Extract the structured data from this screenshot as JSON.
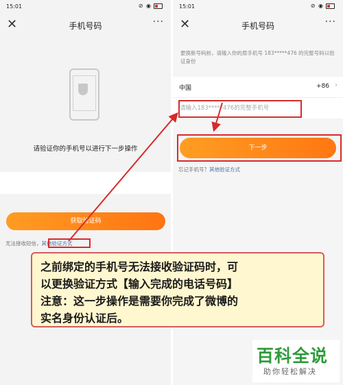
{
  "left_screen": {
    "status": {
      "time": "15:01",
      "signal": "ᴴᴰ",
      "right_icons": "⊘ ◉"
    },
    "nav": {
      "close_glyph": "✕",
      "title": "手机号码",
      "more_glyph": "···"
    },
    "message": "请验证你的手机号以进行下一步操作",
    "get_code_button": "获取验证码",
    "help_text": "无法接收短信，",
    "other_method_link": "其他验证方式"
  },
  "right_screen": {
    "status": {
      "time": "15:01",
      "signal": "ᴴᴰ",
      "right_icons": "⊘ ◉"
    },
    "nav": {
      "close_glyph": "✕",
      "title": "手机号码",
      "more_glyph": "···"
    },
    "description": "更换新号码前，请输入你的原手机号 183*****476 的完整号码以验证身份",
    "country": "中国",
    "country_code": "+86",
    "chevron": "›",
    "phone_placeholder": "请输入183*****476的完整手机号",
    "next_button": "下一步",
    "forgot_text": "忘记手机号？",
    "other_method_link": "其他验证方式"
  },
  "callout": {
    "line1": "之前绑定的手机号无法接收验证码时，可",
    "line2": "以更换验证方式【输入完成的电话号码】",
    "line3": "注意：这一步操作是需要你完成了微博的",
    "line4": "实名身份认证后。"
  },
  "watermark": {
    "title": "百科全说",
    "subtitle": "助你轻松解决"
  },
  "colors": {
    "accent_orange": "#ff8a1a",
    "highlight_red": "#d62b2b",
    "link_blue": "#4b6fa3",
    "callout_bg": "#fff7cf",
    "watermark_green": "#2f9b3b"
  }
}
